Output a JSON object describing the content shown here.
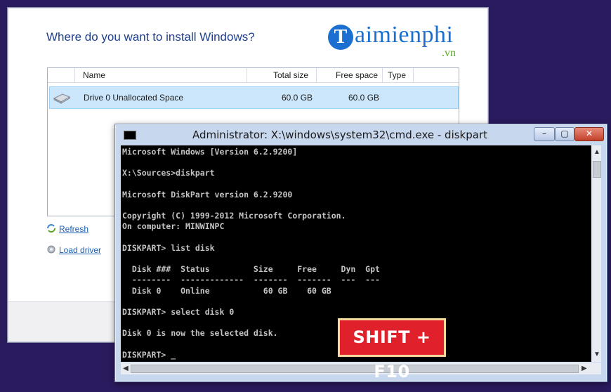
{
  "setup": {
    "title": "Where do you want to install Windows?",
    "brand": {
      "logo_letter": "T",
      "name": "aimienphi",
      "tld": ".vn"
    },
    "columns": {
      "name": "Name",
      "total": "Total size",
      "free": "Free space",
      "type": "Type"
    },
    "drive": {
      "name": "Drive 0 Unallocated Space",
      "total": "60.0 GB",
      "free": "60.0 GB",
      "type": ""
    },
    "links": {
      "refresh": "Refresh",
      "load_driver": "Load driver"
    }
  },
  "cmd": {
    "title": "Administrator: X:\\windows\\system32\\cmd.exe - diskpart",
    "lines": [
      "Microsoft Windows [Version 6.2.9200]",
      "",
      "X:\\Sources>diskpart",
      "",
      "Microsoft DiskPart version 6.2.9200",
      "",
      "Copyright (C) 1999-2012 Microsoft Corporation.",
      "On computer: MINWINPC",
      "",
      "DISKPART> list disk",
      "",
      "  Disk ###  Status         Size     Free     Dyn  Gpt",
      "  --------  -------------  -------  -------  ---  ---",
      "  Disk 0    Online           60 GB    60 GB",
      "",
      "DISKPART> select disk 0",
      "",
      "Disk 0 is now the selected disk.",
      "",
      "DISKPART> _"
    ]
  },
  "hotkey": "SHIFT + F10",
  "colors": {
    "accent": "#1a6fd0",
    "hotkey_bg": "#e0202a",
    "console_bg": "#000000"
  }
}
